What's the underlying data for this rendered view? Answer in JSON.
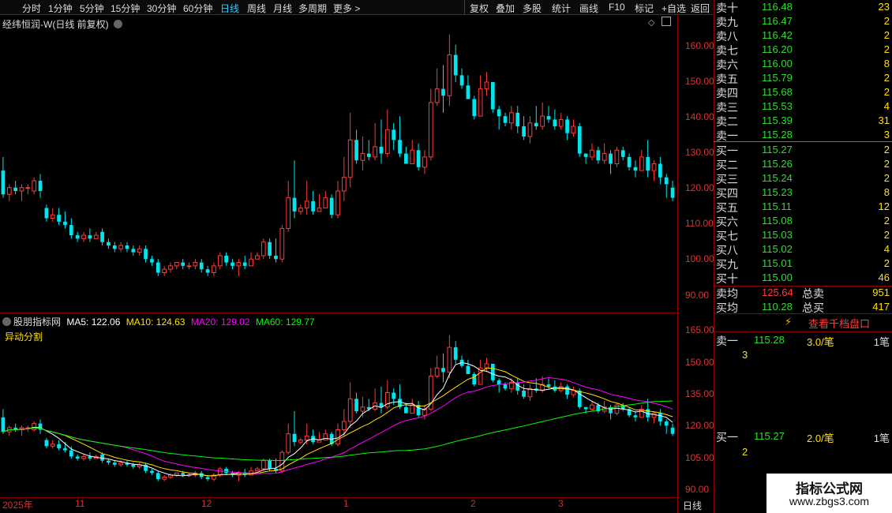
{
  "toolbar": {
    "left_items": [
      "分时",
      "1分钟",
      "5分钟",
      "15分钟",
      "30分钟",
      "60分钟",
      "日线",
      "周线",
      "月线",
      "多周期",
      "更多 >"
    ],
    "active": "日线",
    "right_items": [
      "复权",
      "叠加",
      "多股",
      "统计",
      "画线",
      "F10",
      "标记",
      "+自选",
      "返回"
    ]
  },
  "main_title": {
    "stock": "经纬恒润-W(日线 前复权)"
  },
  "price_axis": [
    "160.00",
    "150.00",
    "140.00",
    "130.00",
    "120.00",
    "110.00",
    "100.00",
    "90.00"
  ],
  "indicator": {
    "name": "股朋指标网",
    "ma5": "MA5: 122.06",
    "ma10": "MA10: 124.63",
    "ma20": "MA20: 129.02",
    "ma60": "MA60: 129.77",
    "sub": "异动分割",
    "axis": [
      "165.00",
      "150.00",
      "135.00",
      "120.00",
      "105.00",
      "90.00"
    ]
  },
  "x_labels": [
    "2025年",
    "11",
    "12",
    "1",
    "2",
    "3"
  ],
  "period_label": "日线",
  "order_book": {
    "asks": [
      {
        "label": "卖十",
        "price": "116.48",
        "vol": "23"
      },
      {
        "label": "卖九",
        "price": "116.47",
        "vol": "2"
      },
      {
        "label": "卖八",
        "price": "116.42",
        "vol": "2"
      },
      {
        "label": "卖七",
        "price": "116.20",
        "vol": "2"
      },
      {
        "label": "卖六",
        "price": "116.00",
        "vol": "8"
      },
      {
        "label": "卖五",
        "price": "115.79",
        "vol": "2"
      },
      {
        "label": "卖四",
        "price": "115.68",
        "vol": "2"
      },
      {
        "label": "卖三",
        "price": "115.53",
        "vol": "4"
      },
      {
        "label": "卖二",
        "price": "115.39",
        "vol": "31"
      },
      {
        "label": "卖一",
        "price": "115.28",
        "vol": "3"
      }
    ],
    "bids": [
      {
        "label": "买一",
        "price": "115.27",
        "vol": "2"
      },
      {
        "label": "买二",
        "price": "115.26",
        "vol": "2"
      },
      {
        "label": "买三",
        "price": "115.24",
        "vol": "2"
      },
      {
        "label": "买四",
        "price": "115.23",
        "vol": "8"
      },
      {
        "label": "买五",
        "price": "115.11",
        "vol": "12"
      },
      {
        "label": "买六",
        "price": "115.08",
        "vol": "2"
      },
      {
        "label": "买七",
        "price": "115.03",
        "vol": "2"
      },
      {
        "label": "买八",
        "price": "115.02",
        "vol": "4"
      },
      {
        "label": "买九",
        "price": "115.01",
        "vol": "2"
      },
      {
        "label": "买十",
        "price": "115.00",
        "vol": "46"
      }
    ],
    "sell_avg": {
      "label": "卖均",
      "price": "125.64",
      "tlabel": "总卖",
      "total": "951"
    },
    "buy_avg": {
      "label": "买均",
      "price": "110.28",
      "tlabel": "总买",
      "total": "417"
    },
    "thousand_btn": "查看千档盘口",
    "ask1_detail": {
      "label": "卖一",
      "price": "115.28",
      "amount": "3.0/笔",
      "count": "1笔",
      "queue": "3"
    },
    "bid1_detail": {
      "label": "买一",
      "price": "115.27",
      "amount": "2.0/笔",
      "count": "1笔",
      "queue": "2"
    }
  },
  "watermark": {
    "line1": "指标公式网",
    "line2": "www.zbgs3.com"
  },
  "colors": {
    "up": "#ff3b3b",
    "down": "#00e5ee",
    "ma5": "#ffffff",
    "ma10": "#ffe000",
    "ma20": "#ff00ff",
    "ma60": "#00ff00"
  },
  "chart_data": {
    "type": "candlestick",
    "price_range": [
      86,
      166
    ],
    "candles": [
      [
        124,
        117,
        128,
        116
      ],
      [
        117,
        119,
        120,
        115
      ],
      [
        119,
        118,
        121,
        117
      ],
      [
        118,
        119,
        120,
        115
      ],
      [
        119,
        119,
        120,
        117
      ],
      [
        118,
        121,
        122,
        117
      ],
      [
        121,
        118,
        123,
        116
      ],
      [
        113,
        110,
        114,
        109
      ],
      [
        110,
        111,
        113,
        109
      ],
      [
        111,
        109,
        113,
        108
      ],
      [
        109,
        108,
        112,
        107
      ],
      [
        108,
        105,
        110,
        104
      ],
      [
        105,
        104,
        106,
        103
      ],
      [
        104,
        105,
        106,
        103
      ],
      [
        105,
        104,
        107,
        103
      ],
      [
        104,
        105,
        106,
        104
      ],
      [
        106,
        103,
        107,
        102
      ],
      [
        103,
        102,
        104,
        101
      ],
      [
        102,
        101,
        103,
        100
      ],
      [
        101,
        102,
        103,
        100
      ],
      [
        102,
        101,
        103,
        100
      ],
      [
        101,
        100,
        102,
        99
      ],
      [
        100,
        101,
        102,
        99
      ],
      [
        101,
        98,
        102,
        97
      ],
      [
        98,
        97,
        99,
        96
      ],
      [
        97,
        94,
        98,
        93
      ],
      [
        94,
        95,
        96,
        93
      ],
      [
        95,
        96,
        97,
        94
      ],
      [
        96,
        97,
        97,
        95
      ],
      [
        97,
        96,
        98,
        95
      ],
      [
        96,
        96,
        97,
        95
      ],
      [
        96,
        97,
        98,
        95
      ],
      [
        97,
        95,
        98,
        94
      ],
      [
        95,
        94,
        96,
        93
      ],
      [
        94,
        96,
        97,
        93
      ],
      [
        96,
        99,
        100,
        95
      ],
      [
        99,
        97,
        100,
        96
      ],
      [
        97,
        96,
        98,
        95
      ],
      [
        96,
        97,
        98,
        93
      ],
      [
        97,
        96,
        99,
        95
      ],
      [
        96,
        98,
        100,
        96
      ],
      [
        98,
        99,
        100,
        98
      ],
      [
        99,
        103,
        104,
        98
      ],
      [
        103,
        99,
        104,
        98
      ],
      [
        99,
        98,
        104,
        97
      ],
      [
        98,
        107,
        108,
        97
      ],
      [
        107,
        116,
        121,
        106
      ],
      [
        116,
        112,
        127,
        110
      ],
      [
        112,
        113,
        114,
        111
      ],
      [
        113,
        115,
        121,
        111
      ],
      [
        115,
        112,
        118,
        111
      ],
      [
        112,
        113,
        117,
        112
      ],
      [
        113,
        116,
        118,
        113
      ],
      [
        116,
        111,
        117,
        110
      ],
      [
        111,
        118,
        121,
        110
      ],
      [
        118,
        122,
        128,
        115
      ],
      [
        122,
        133,
        141,
        119
      ],
      [
        133,
        127,
        136,
        126
      ],
      [
        127,
        129,
        134,
        124
      ],
      [
        129,
        128,
        133,
        127
      ],
      [
        128,
        131,
        138,
        127
      ],
      [
        131,
        129,
        139,
        126
      ],
      [
        129,
        136,
        142,
        128
      ],
      [
        136,
        133,
        138,
        130
      ],
      [
        133,
        129,
        140,
        128
      ],
      [
        129,
        126,
        131,
        126
      ],
      [
        126,
        130,
        133,
        126
      ],
      [
        130,
        125,
        132,
        124
      ],
      [
        125,
        128,
        130,
        123
      ],
      [
        128,
        144,
        148,
        127
      ],
      [
        144,
        148,
        154,
        143
      ],
      [
        148,
        146,
        155,
        141
      ],
      [
        146,
        158,
        164,
        143
      ],
      [
        158,
        152,
        161,
        150
      ],
      [
        152,
        149,
        154,
        148
      ],
      [
        149,
        145,
        152,
        146
      ],
      [
        145,
        140,
        146,
        139
      ],
      [
        140,
        148,
        152,
        140
      ],
      [
        148,
        150,
        153,
        146
      ],
      [
        150,
        142,
        150,
        141
      ],
      [
        142,
        140,
        143,
        136
      ],
      [
        140,
        138,
        141,
        137
      ],
      [
        138,
        141,
        143,
        136
      ],
      [
        141,
        137,
        143,
        135
      ],
      [
        137,
        134,
        140,
        133
      ],
      [
        134,
        138,
        140,
        132
      ],
      [
        138,
        137,
        143,
        136
      ],
      [
        137,
        140,
        144,
        136
      ],
      [
        140,
        139,
        143,
        138
      ],
      [
        139,
        137,
        142,
        136
      ],
      [
        137,
        139,
        141,
        136
      ],
      [
        139,
        135,
        140,
        133
      ],
      [
        135,
        137,
        139,
        134
      ],
      [
        137,
        129,
        138,
        128
      ],
      [
        129,
        128,
        129,
        126
      ],
      [
        128,
        130,
        132,
        127
      ],
      [
        130,
        127,
        131,
        126
      ],
      [
        127,
        129,
        132,
        126
      ],
      [
        129,
        126,
        130,
        123
      ],
      [
        126,
        130,
        131,
        125
      ],
      [
        130,
        128,
        131,
        127
      ],
      [
        128,
        125,
        129,
        124
      ],
      [
        125,
        124,
        127,
        122
      ],
      [
        124,
        128,
        130,
        124
      ],
      [
        128,
        124,
        133,
        122
      ],
      [
        124,
        126,
        127,
        121
      ],
      [
        126,
        122,
        128,
        120
      ],
      [
        122,
        120,
        123,
        116
      ],
      [
        119,
        116,
        121,
        115
      ]
    ]
  }
}
